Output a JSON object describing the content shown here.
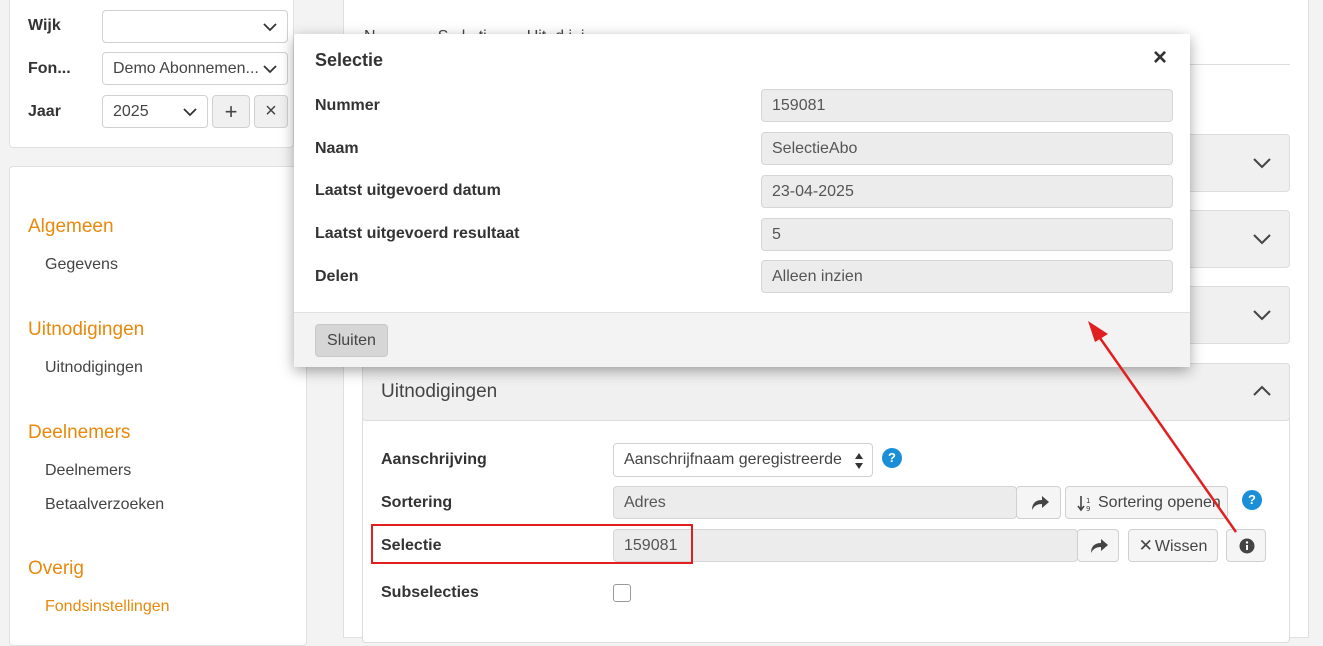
{
  "filters": {
    "wijk_label": "Wijk",
    "wijk_value": "",
    "fonds_label": "Fon...",
    "fonds_value": "Demo Abonnemen...",
    "jaar_label": "Jaar",
    "jaar_value": "2025",
    "add_symbol": "+",
    "remove_symbol": "×"
  },
  "nav": {
    "sections": [
      {
        "title": "Algemeen",
        "items": [
          "Gegevens"
        ]
      },
      {
        "title": "Uitnodigingen",
        "items": [
          "Uitnodigingen"
        ]
      },
      {
        "title": "Deelnemers",
        "items": [
          "Deelnemers",
          "Betaalverzoeken"
        ]
      },
      {
        "title": "Overig",
        "items": [
          "Fondsinstellingen"
        ]
      }
    ],
    "active_item": "Fondsinstellingen"
  },
  "main": {
    "tabs_text": "N              S   l   ti         Uit  d i  i",
    "uitnodigingen_header": "Uitnodigingen",
    "form": {
      "aanschrijving_label": "Aanschrijving",
      "aanschrijving_value": "Aanschrijfnaam geregistreerde",
      "sortering_label": "Sortering",
      "sortering_value": "Adres",
      "sortering_open_label": "Sortering openen",
      "selectie_label": "Selectie",
      "selectie_value": "159081",
      "wissen_label": "Wissen",
      "subselecties_label": "Subselecties",
      "help_symbol": "?"
    }
  },
  "modal": {
    "title": "Selectie",
    "close_symbol": "×",
    "rows": [
      {
        "label": "Nummer",
        "value": "159081"
      },
      {
        "label": "Naam",
        "value": "SelectieAbo"
      },
      {
        "label": "Laatst uitgevoerd datum",
        "value": "23-04-2025"
      },
      {
        "label": "Laatst uitgevoerd resultaat",
        "value": "5"
      },
      {
        "label": "Delen",
        "value": "Alleen inzien"
      }
    ],
    "close_button_label": "Sluiten"
  },
  "colors": {
    "accent_orange": "#e8890c",
    "annotation_red": "#e02020",
    "help_blue": "#1a8fd8"
  }
}
